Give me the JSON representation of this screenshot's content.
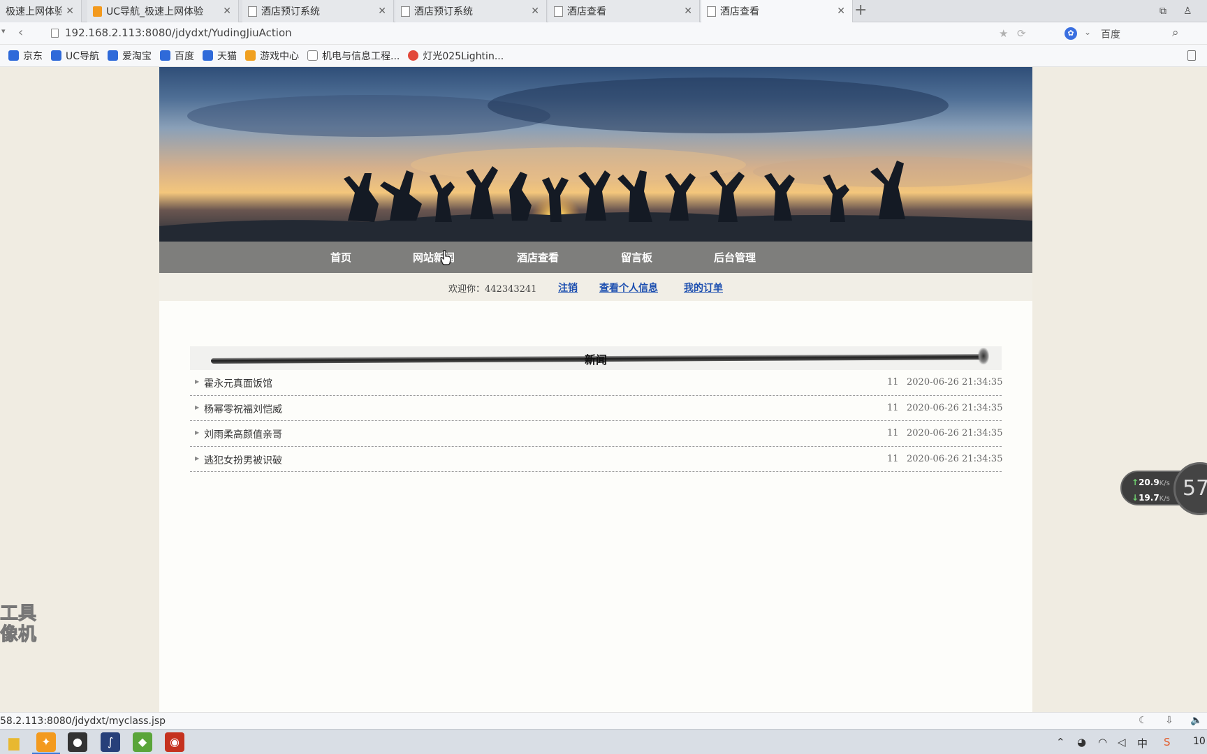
{
  "browser": {
    "tabs": [
      {
        "title": "极速上网体验",
        "active": false
      },
      {
        "title": "UC导航_极速上网体验",
        "active": false
      },
      {
        "title": "酒店预订系统",
        "active": false
      },
      {
        "title": "酒店预订系统",
        "active": false
      },
      {
        "title": "酒店查看",
        "active": false
      },
      {
        "title": "酒店查看",
        "active": true
      }
    ],
    "url": "192.168.2.113:8080/jdydxt/YudingJiuAction",
    "search_engine": "百度",
    "bookmarks": [
      {
        "label": "京东",
        "color": "#2f6ad9"
      },
      {
        "label": "UC导航",
        "color": "#2f6ad9"
      },
      {
        "label": "爱淘宝",
        "color": "#2f6ad9"
      },
      {
        "label": "百度",
        "color": "#2f6ad9"
      },
      {
        "label": "天猫",
        "color": "#2f6ad9"
      },
      {
        "label": "游戏中心",
        "color": "#f0a020"
      },
      {
        "label": "机电与信息工程...",
        "color": "#888888"
      },
      {
        "label": "灯光025Lightin...",
        "color": "#e2483a"
      }
    ],
    "status_url": "58.2.113:8080/jdydxt/myclass.jsp"
  },
  "site": {
    "nav": [
      "首页",
      "网站新闻",
      "酒店查看",
      "留言板",
      "后台管理"
    ],
    "welcome_label": "欢迎你：442343241",
    "user_links": [
      "注销",
      "查看个人信息",
      "我的订单"
    ],
    "news_title": "新闻",
    "news": [
      {
        "title": "霍永元真面饭馆",
        "count": "11",
        "date": "2020-06-26 21:34:35"
      },
      {
        "title": "杨幂零祝福刘恺威",
        "count": "11",
        "date": "2020-06-26 21:34:35"
      },
      {
        "title": "刘雨柔高颜值亲哥",
        "count": "11",
        "date": "2020-06-26 21:34:35"
      },
      {
        "title": "逃犯女扮男被识破",
        "count": "11",
        "date": "2020-06-26 21:34:35"
      }
    ]
  },
  "overlays": {
    "watermark_line1": "工具",
    "watermark_line2": "像机",
    "speed_up": "20.9",
    "speed_down": "19.7",
    "speed_unit": "K/s",
    "gauge_value": "57"
  },
  "taskbar": {
    "clock": "10"
  },
  "colors": {
    "navbar": "#7e7e7c",
    "link": "#1d4fb0",
    "page_bg": "#f0ece2"
  }
}
